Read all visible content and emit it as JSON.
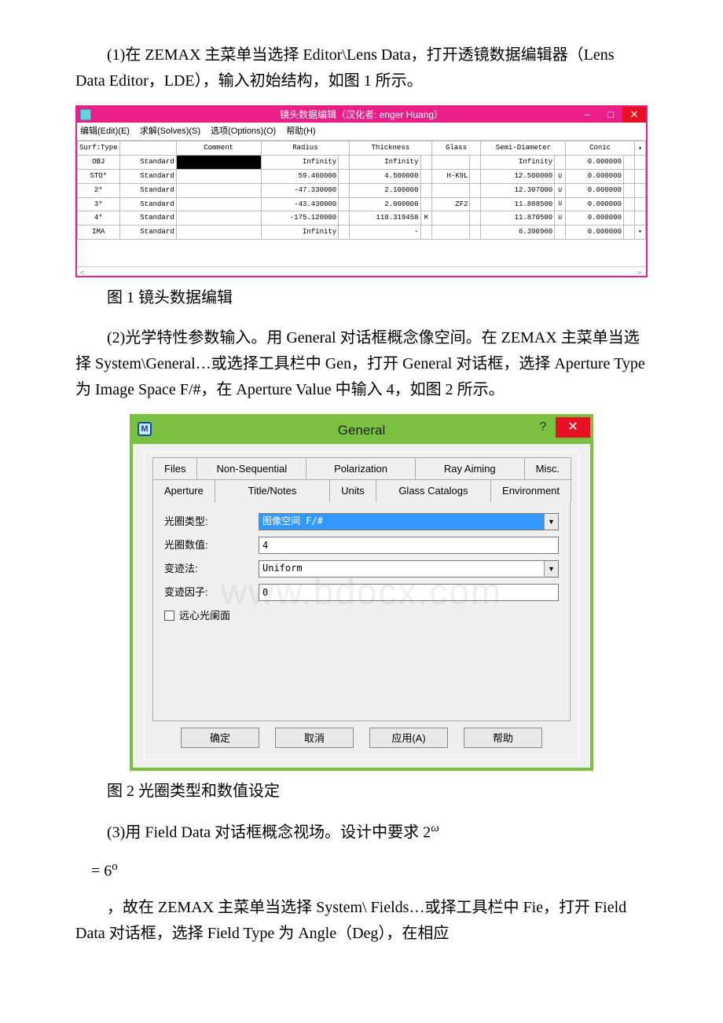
{
  "body": {
    "para1": "(1)在 ZEMAX 主菜单当选择 Editor\\Lens Data，打开透镜数据编辑器（Lens Data Editor，LDE），输入初始结构，如图 1 所示。",
    "caption1": "图 1 镜头数据编辑",
    "para2": "(2)光学特性参数输入。用 General 对话框概念像空间。在 ZEMAX 主菜单当选择 System\\General…或选择工具栏中 Gen，打开 General 对话框，选择 Aperture Type 为 Image Space F/#，在 Aperture Value 中输入 4，如图 2 所示。",
    "caption2": "图 2 光圈类型和数值设定",
    "para3a": "(3)用 Field Data 对话框概念视场。设计中要求 2",
    "para3_omega": "ω",
    "para3b": "= 6",
    "para3_deg": "o",
    "para4": "，故在 ZEMAX 主菜单当选择 System\\ Fields…或择工具栏中 Fie，打开 Field Data 对话框，选择 Field Type 为 Angle（Deg），在相应"
  },
  "lde": {
    "title": "镜头数据编辑（汉化者: enger Huang）",
    "menu": [
      "编辑(Edit)(E)",
      "求解(Solves)(S)",
      "选项(Options)(O)",
      "帮助(H)"
    ],
    "headers": [
      "Surf:Type",
      "Comment",
      "Radius",
      "Thickness",
      "Glass",
      "Semi-Diameter",
      "Conic"
    ],
    "rows": [
      {
        "surf": "OBJ",
        "type": "Standard",
        "comment": "",
        "radius": "Infinity",
        "rflag": "",
        "thick": "Infinity",
        "tflag": "",
        "glass": "",
        "semi": "Infinity",
        "sflag": "",
        "conic": "0.000000"
      },
      {
        "surf": "STO*",
        "type": "Standard",
        "comment": "",
        "radius": "59.460000",
        "rflag": "",
        "thick": "4.500000",
        "tflag": "",
        "glass": "H-K9L",
        "semi": "12.500000",
        "sflag": "U",
        "conic": "0.000000"
      },
      {
        "surf": "2*",
        "type": "Standard",
        "comment": "",
        "radius": "-47.330000",
        "rflag": "",
        "thick": "2.100000",
        "tflag": "",
        "glass": "",
        "semi": "12.307000",
        "sflag": "U",
        "conic": "0.000000"
      },
      {
        "surf": "3*",
        "type": "Standard",
        "comment": "",
        "radius": "-43.430000",
        "rflag": "",
        "thick": "2.000000",
        "tflag": "",
        "glass": "ZF2",
        "semi": "11.888500",
        "sflag": "U",
        "conic": "0.000000"
      },
      {
        "surf": "4*",
        "type": "Standard",
        "comment": "",
        "radius": "-175.120000",
        "rflag": "",
        "thick": "110.319458",
        "tflag": "M",
        "glass": "",
        "semi": "11.870500",
        "sflag": "U",
        "conic": "0.000000"
      },
      {
        "surf": "IMA",
        "type": "Standard",
        "comment": "",
        "radius": "Infinity",
        "rflag": "",
        "thick": "-",
        "tflag": "",
        "glass": "",
        "semi": "6.390960",
        "sflag": "",
        "conic": "0.000000"
      }
    ]
  },
  "general": {
    "title": "General",
    "tabs_back": [
      "Files",
      "Non-Sequential",
      "Polarization",
      "Ray Aiming",
      "Misc."
    ],
    "tabs_front": [
      "Aperture",
      "Title/Notes",
      "Units",
      "Glass Catalogs",
      "Environment"
    ],
    "labels": {
      "apertureType": "光圈类型:",
      "apertureValue": "光圈数值:",
      "apodization": "变迹法:",
      "apodFactor": "变迹因子:",
      "telecentric": "远心光阑面"
    },
    "values": {
      "apertureType": "图像空间 F/#",
      "apertureValue": "4",
      "apodization": "Uniform",
      "apodFactor": "0"
    },
    "buttons": {
      "ok": "确定",
      "cancel": "取消",
      "apply": "应用(A)",
      "help": "帮助"
    }
  }
}
